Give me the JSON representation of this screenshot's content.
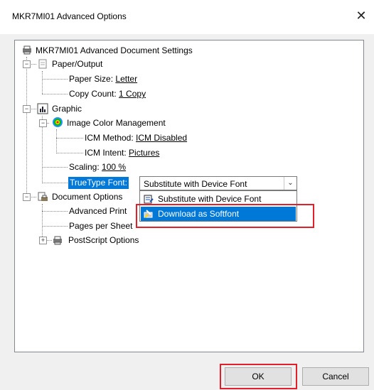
{
  "window": {
    "title": "MKR7MI01 Advanced Options",
    "close_glyph": "✕"
  },
  "tree": {
    "root": "MKR7MI01 Advanced Document Settings",
    "paper_output": "Paper/Output",
    "paper_size_label": "Paper Size:",
    "paper_size_value": "Letter",
    "copy_count_label": "Copy Count:",
    "copy_count_value": "1 Copy",
    "graphic": "Graphic",
    "icm": "Image Color Management",
    "icm_method_label": "ICM Method:",
    "icm_method_value": "ICM Disabled",
    "icm_intent_label": "ICM Intent:",
    "icm_intent_value": "Pictures",
    "scaling_label": "Scaling:",
    "scaling_value": "100 %",
    "truetype_label": "TrueType Font:",
    "doc_options": "Document Options",
    "advanced_print": "Advanced Print",
    "pages_per_sheet": "Pages per Sheet",
    "postscript": "PostScript Options"
  },
  "truetype_combo": {
    "value": "Substitute with Device Font",
    "options": [
      "Substitute with Device Font",
      "Download as Softfont"
    ],
    "highlighted": "Download as Softfont"
  },
  "buttons": {
    "ok": "OK",
    "cancel": "Cancel"
  },
  "colors": {
    "highlight": "#0078d7",
    "annotation": "#e0202a"
  }
}
